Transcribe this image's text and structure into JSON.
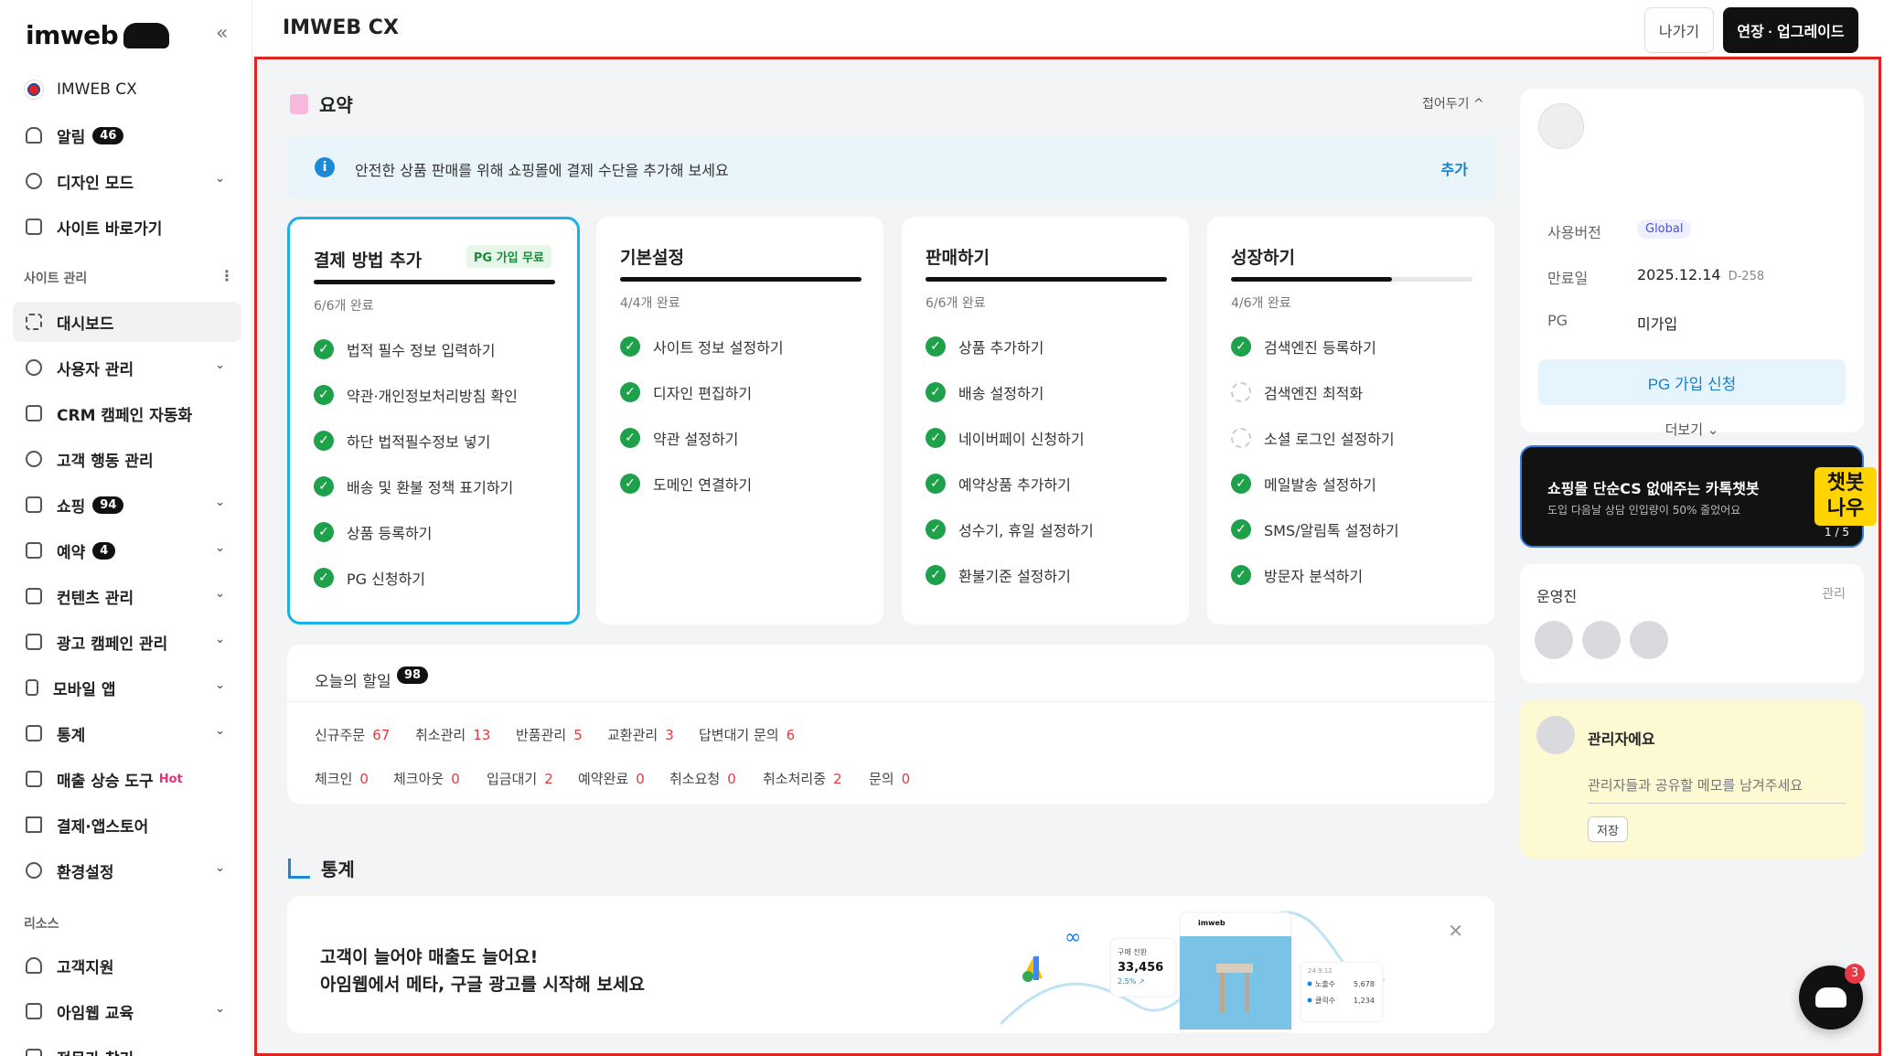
{
  "sidebar": {
    "logo": "imweb",
    "site_name": "IMWEB CX",
    "items_top": [
      {
        "label": "알림",
        "badge": "46"
      },
      {
        "label": "디자인 모드"
      },
      {
        "label": "사이트 바로가기"
      }
    ],
    "section_site": "사이트 관리",
    "items": [
      {
        "label": "대시보드"
      },
      {
        "label": "사용자 관리"
      },
      {
        "label": "CRM 캠페인 자동화"
      },
      {
        "label": "고객 행동 관리"
      },
      {
        "label": "쇼핑",
        "badge": "94"
      },
      {
        "label": "예약",
        "badge": "4"
      },
      {
        "label": "컨텐츠 관리"
      },
      {
        "label": "광고 캠페인 관리"
      },
      {
        "label": "모바일 앱"
      },
      {
        "label": "통계"
      },
      {
        "label": "매출 상승 도구",
        "hot": "Hot"
      },
      {
        "label": "결제·앱스토어"
      },
      {
        "label": "환경설정"
      }
    ],
    "section_resource": "리소스",
    "resources": [
      {
        "label": "고객지원"
      },
      {
        "label": "아임웹 교육"
      },
      {
        "label": "전문가 찾기"
      }
    ]
  },
  "header": {
    "title": "IMWEB CX",
    "exit": "나가기",
    "upgrade": "연장 · 업그레이드"
  },
  "summary": {
    "title": "요약",
    "fold": "접어두기 ^",
    "notice": {
      "text": "안전한 상품 판매를 위해 쇼핑몰에 결제 수단을 추가해 보세요",
      "action": "추가"
    },
    "cards": [
      {
        "title": "결제 방법 추가",
        "tag": "PG 가입 무료",
        "count": "6/6개 완료",
        "progress": 1.0,
        "tasks": [
          "법적 필수 정보 입력하기",
          "약관·개인정보처리방침 확인",
          "하단 법적필수정보 넣기",
          "배송 및 환불 정책 표기하기",
          "상품 등록하기",
          "PG 신청하기"
        ]
      },
      {
        "title": "기본설정",
        "count": "4/4개 완료",
        "progress": 1.0,
        "tasks": [
          "사이트 정보 설정하기",
          "디자인 편집하기",
          "약관 설정하기",
          "도메인 연결하기"
        ]
      },
      {
        "title": "판매하기",
        "count": "6/6개 완료",
        "progress": 1.0,
        "tasks": [
          "상품 추가하기",
          "배송 설정하기",
          "네이버페이 신청하기",
          "예약상품 추가하기",
          "성수기, 휴일 설정하기",
          "환불기준 설정하기"
        ]
      },
      {
        "title": "성장하기",
        "count": "4/6개 완료",
        "progress": 0.667,
        "tasks": [
          "검색엔진 등록하기",
          "검색엔진 최적화",
          "소셜 로그인 설정하기",
          "메일발송 설정하기",
          "SMS/알림톡 설정하기",
          "방문자 분석하기"
        ]
      }
    ]
  },
  "todo": {
    "label": "오늘의 할일",
    "count": "98",
    "row1": [
      {
        "l": "신규주문",
        "n": "67"
      },
      {
        "l": "취소관리",
        "n": "13"
      },
      {
        "l": "반품관리",
        "n": "5"
      },
      {
        "l": "교환관리",
        "n": "3"
      },
      {
        "l": "답변대기 문의",
        "n": "6"
      }
    ],
    "row2": [
      {
        "l": "체크인",
        "n": "0"
      },
      {
        "l": "체크아웃",
        "n": "0"
      },
      {
        "l": "입금대기",
        "n": "2"
      },
      {
        "l": "예약완료",
        "n": "0"
      },
      {
        "l": "취소요청",
        "n": "0"
      },
      {
        "l": "취소처리중",
        "n": "2"
      },
      {
        "l": "문의",
        "n": "0"
      }
    ]
  },
  "stats": {
    "title": "통계",
    "ad_line1": "고객이 늘어야 매출도 늘어요!",
    "ad_line2": "아임웹에서 메타, 구글 광고를 시작해 보세요",
    "mock": {
      "conv_label": "구매 전환",
      "conv": "33,456",
      "conv_rate": "2.5% ↗",
      "brand": "imweb",
      "date": "24.9.12",
      "impr_label": "노출수",
      "impr": "5,678",
      "click_label": "클릭수",
      "click": "1,234"
    }
  },
  "info": {
    "version_label": "사용버전",
    "version": "Global",
    "expire_label": "만료일",
    "expire": "2025.12.14",
    "dday": "D-258",
    "pg_label": "PG",
    "pg": "미가입",
    "pg_button": "PG 가입 신청",
    "more": "더보기 ⌄"
  },
  "banner": {
    "t1": "쇼핑몰 단순CS 없애주는 카톡챗봇",
    "t2": "도입 다음날 상담 인입량이 50% 줄었어요",
    "badge": "챗봇 나우",
    "page": "1 / 5"
  },
  "team": {
    "title": "운영진",
    "manage": "관리"
  },
  "memo": {
    "title": "관리자에요",
    "placeholder": "관리자들과 공유할 메모를 남겨주세요",
    "save": "저장"
  },
  "fab": {
    "count": "3"
  },
  "colors": {
    "accent": "#1a8ad8",
    "check": "#1fa04a",
    "highlight_border": "#e02424"
  }
}
